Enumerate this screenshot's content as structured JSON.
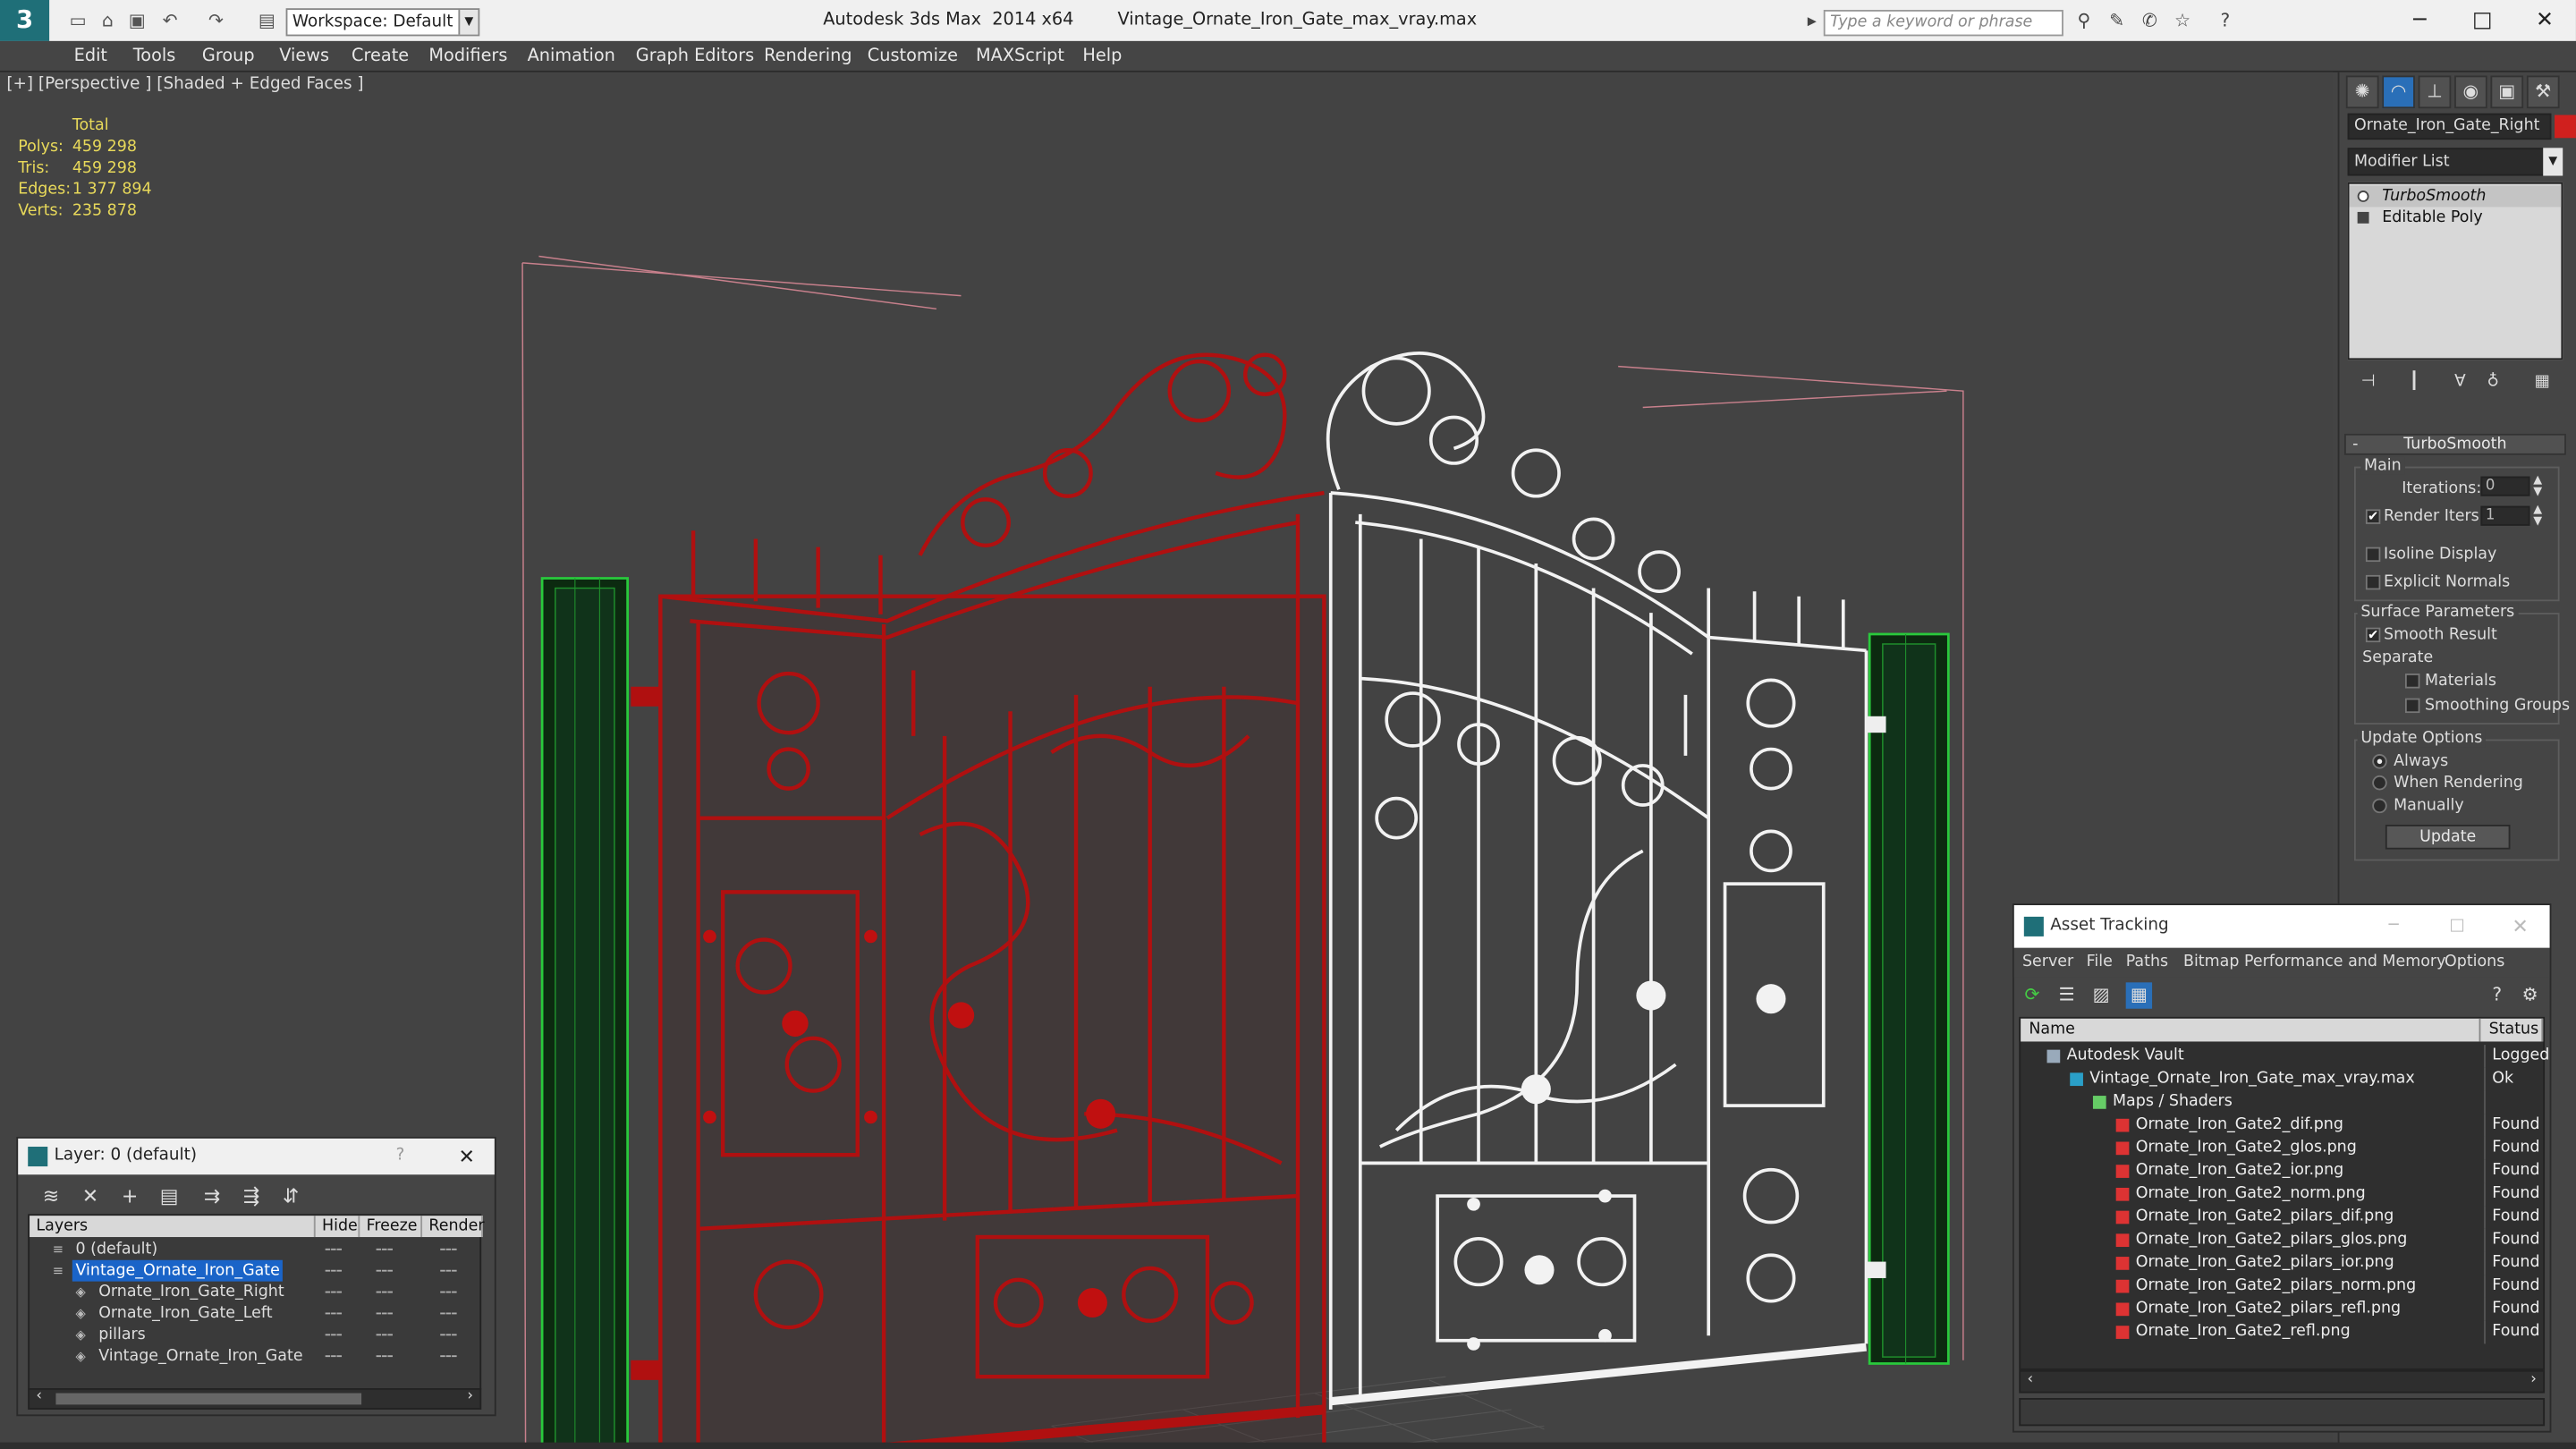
{
  "titlebar": {
    "app_title": "Autodesk 3ds Max  2014 x64        Vintage_Ornate_Iron_Gate_max_vray.max",
    "workspace": "Workspace: Default",
    "search_placeholder": "Type a keyword or phrase"
  },
  "menu": [
    "Edit",
    "Tools",
    "Group",
    "Views",
    "Create",
    "Modifiers",
    "Animation",
    "Graph Editors",
    "Rendering",
    "Customize",
    "MAXScript",
    "Help"
  ],
  "viewport": {
    "label": "[+] [Perspective ] [Shaded + Edged Faces ]",
    "stats_header": "Total",
    "stats": [
      {
        "k": "Polys:",
        "v": "459 298"
      },
      {
        "k": "Tris:",
        "v": "459 298"
      },
      {
        "k": "Edges:",
        "v": "1 377 894"
      },
      {
        "k": "Verts:",
        "v": "235 878"
      }
    ]
  },
  "command_panel": {
    "object_name": "Ornate_Iron_Gate_Right",
    "object_color": "#d0201e",
    "modifier_list": "Modifier List",
    "stack": [
      "TurboSmooth",
      "Editable Poly"
    ],
    "rollout": "TurboSmooth",
    "main_label": "Main",
    "iterations_label": "Iterations:",
    "iterations_value": "0",
    "render_iters_label": "Render Iters:",
    "render_iters_value": "1",
    "isoline": "Isoline Display",
    "explicit": "Explicit Normals",
    "surface_params": "Surface Parameters",
    "smooth_result": "Smooth Result",
    "separate": "Separate",
    "materials": "Materials",
    "smoothing_groups": "Smoothing Groups",
    "update_options": "Update Options",
    "always": "Always",
    "when_rendering": "When Rendering",
    "manually": "Manually",
    "update_button": "Update"
  },
  "layers": {
    "title": "Layer: 0 (default)",
    "help": "?",
    "columns": [
      "Layers",
      "Hide",
      "Freeze",
      "Render"
    ],
    "rows": [
      {
        "name": "0 (default)",
        "indent": 0,
        "sel": false
      },
      {
        "name": "Vintage_Ornate_Iron_Gate",
        "indent": 0,
        "sel": true
      },
      {
        "name": "Ornate_Iron_Gate_Right",
        "indent": 1,
        "sel": false
      },
      {
        "name": "Ornate_Iron_Gate_Left",
        "indent": 1,
        "sel": false
      },
      {
        "name": "pillars",
        "indent": 1,
        "sel": false
      },
      {
        "name": "Vintage_Ornate_Iron_Gate",
        "indent": 1,
        "sel": false
      }
    ]
  },
  "asset_tracking": {
    "title": "Asset Tracking",
    "menu": [
      "Server",
      "File",
      "Paths",
      "Bitmap Performance and Memory",
      "Options"
    ],
    "columns": [
      "Name",
      "Status"
    ],
    "rows": [
      {
        "name": "Autodesk Vault",
        "status": "Logged",
        "indent": 0,
        "icon": "vault"
      },
      {
        "name": "Vintage_Ornate_Iron_Gate_max_vray.max",
        "status": "Ok",
        "indent": 1,
        "icon": "max"
      },
      {
        "name": "Maps / Shaders",
        "status": "",
        "indent": 2,
        "icon": "folder"
      },
      {
        "name": "Ornate_Iron_Gate2_dif.png",
        "status": "Found",
        "indent": 3,
        "icon": "png"
      },
      {
        "name": "Ornate_Iron_Gate2_glos.png",
        "status": "Found",
        "indent": 3,
        "icon": "png"
      },
      {
        "name": "Ornate_Iron_Gate2_ior.png",
        "status": "Found",
        "indent": 3,
        "icon": "png"
      },
      {
        "name": "Ornate_Iron_Gate2_norm.png",
        "status": "Found",
        "indent": 3,
        "icon": "png"
      },
      {
        "name": "Ornate_Iron_Gate2_pilars_dif.png",
        "status": "Found",
        "indent": 3,
        "icon": "png"
      },
      {
        "name": "Ornate_Iron_Gate2_pilars_glos.png",
        "status": "Found",
        "indent": 3,
        "icon": "png"
      },
      {
        "name": "Ornate_Iron_Gate2_pilars_ior.png",
        "status": "Found",
        "indent": 3,
        "icon": "png"
      },
      {
        "name": "Ornate_Iron_Gate2_pilars_norm.png",
        "status": "Found",
        "indent": 3,
        "icon": "png"
      },
      {
        "name": "Ornate_Iron_Gate2_pilars_refl.png",
        "status": "Found",
        "indent": 3,
        "icon": "png"
      },
      {
        "name": "Ornate_Iron_Gate2_refl.png",
        "status": "Found",
        "indent": 3,
        "icon": "png"
      }
    ]
  }
}
